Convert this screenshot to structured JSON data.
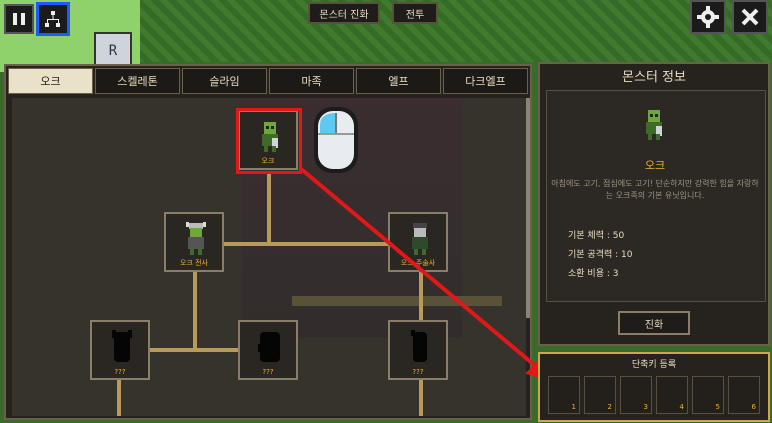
{
  "top": {
    "evolve_tab": "몬스터 진화",
    "battle_tab": "전투",
    "badge_letter": "R"
  },
  "tabs": [
    {
      "label": "오크",
      "active": true
    },
    {
      "label": "스켈레톤",
      "active": false
    },
    {
      "label": "슬라임",
      "active": false
    },
    {
      "label": "마족",
      "active": false
    },
    {
      "label": "엘프",
      "active": false
    },
    {
      "label": "다크엘프",
      "active": false
    }
  ],
  "tree": {
    "nodes": [
      {
        "label": "오크"
      },
      {
        "label": "오크 전사"
      },
      {
        "label": "오크 주술사"
      },
      {
        "label": "???"
      },
      {
        "label": "???"
      },
      {
        "label": "???"
      }
    ]
  },
  "info": {
    "title": "몬스터 정보",
    "name": "오크",
    "desc": "아침에도 고기, 점심에도 고기! 단순하지만 강력한 힘을 자랑하는 오크족의 기본 유닛입니다.",
    "hp": "기본 체력 : 50",
    "atk": "기본 공격력 : 10",
    "cost": "소환 비용 : 3",
    "evolve_btn": "진화"
  },
  "hotkeys": {
    "title": "단축키 등록",
    "slots": [
      "1",
      "2",
      "3",
      "4",
      "5",
      "6"
    ]
  },
  "colors": {
    "highlight": "#e01818",
    "accent": "#f0b030"
  }
}
